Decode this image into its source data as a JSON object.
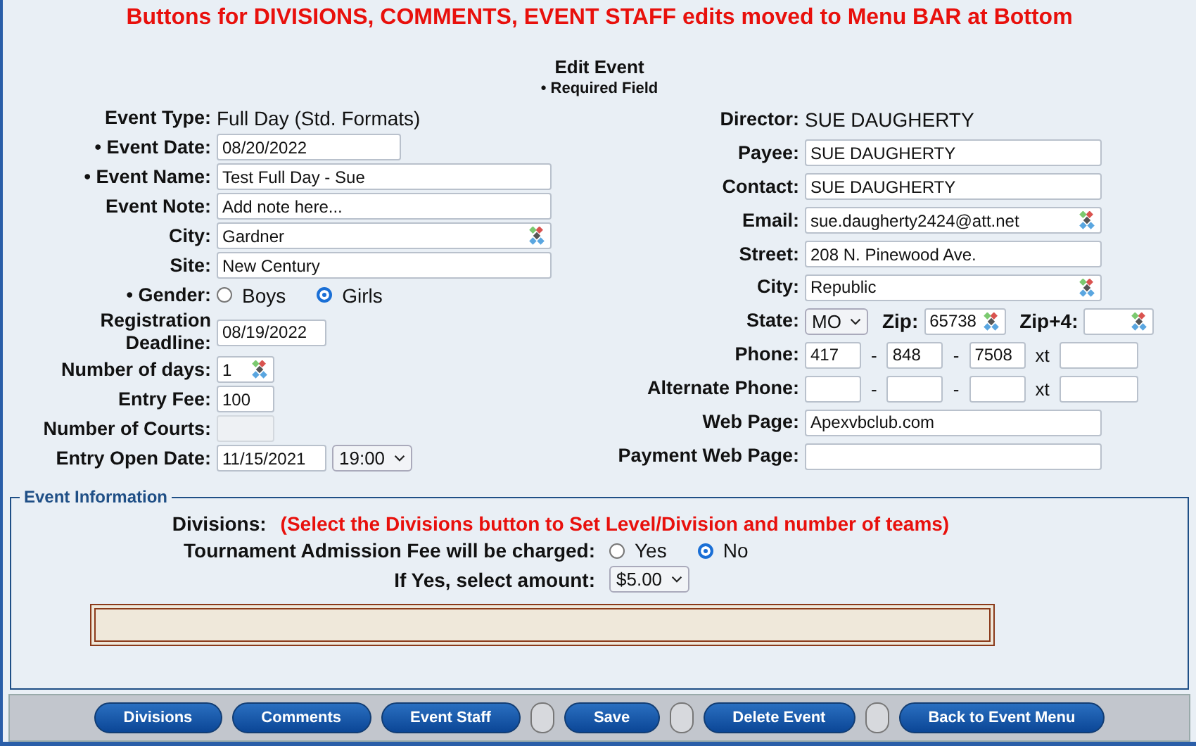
{
  "banner": "Buttons for DIVISIONS, COMMENTS, EVENT STAFF edits moved to Menu BAR at Bottom",
  "title": "Edit Event",
  "required_note": {
    "bullet": "•",
    "text": "Required Field"
  },
  "left_fields": [
    {
      "kind": "static",
      "label": "Event Type:",
      "value": "Full Day (Std. Formats)"
    },
    {
      "kind": "date",
      "label": "• Event Date:",
      "value": "08/20/2022"
    },
    {
      "kind": "wide",
      "label": "• Event Name:",
      "value": "Test Full Day - Sue"
    },
    {
      "kind": "wide",
      "label": "Event Note:",
      "value": "Add note here..."
    },
    {
      "kind": "wide",
      "label": "City:",
      "value": "Gardner",
      "picker": true
    },
    {
      "kind": "wide",
      "label": "Site:",
      "value": "New Century"
    },
    {
      "kind": "radio",
      "label": "• Gender:",
      "options": [
        {
          "label": "Boys",
          "selected": false
        },
        {
          "label": "Girls",
          "selected": true
        }
      ]
    },
    {
      "kind": "narrow",
      "label": "Registration Deadline:",
      "value": "08/19/2022"
    },
    {
      "kind": "small",
      "label": "Number of days:",
      "value": "1",
      "picker": true
    },
    {
      "kind": "small",
      "label": "Entry Fee:",
      "value": "100"
    },
    {
      "kind": "small",
      "label": "Number of Courts:",
      "disabled": true
    },
    {
      "kind": "datetime",
      "label": "Entry Open Date:",
      "value": "11/15/2021",
      "time": "19:00"
    }
  ],
  "right_fields": [
    {
      "kind": "static",
      "label": "Director:",
      "value": "SUE DAUGHERTY"
    },
    {
      "kind": "input",
      "label": "Payee:",
      "value": "SUE DAUGHERTY"
    },
    {
      "kind": "input",
      "label": "Contact:",
      "value": "SUE DAUGHERTY"
    },
    {
      "kind": "input",
      "label": "Email:",
      "value": "sue.daugherty2424@att.net",
      "picker": true
    },
    {
      "kind": "input",
      "label": "Street:",
      "value": "208 N. Pinewood Ave."
    },
    {
      "kind": "input",
      "label": "City:",
      "value": "Republic",
      "picker": true
    },
    {
      "kind": "state",
      "label": "State:",
      "value": "MO",
      "zip_label": "Zip:",
      "zip": "65738",
      "zip4_label": "Zip+4:"
    },
    {
      "kind": "phone",
      "label": "Phone:",
      "parts": [
        "417",
        "848",
        "7508"
      ],
      "separators": [
        "-",
        "-"
      ],
      "ext_label": "xt"
    },
    {
      "kind": "phone",
      "label": "Alternate Phone:",
      "separators": [
        "-",
        "-"
      ],
      "ext_label": "xt"
    },
    {
      "kind": "input",
      "label": "Web Page:",
      "value": "Apexvbclub.com"
    },
    {
      "kind": "input",
      "label": "Payment Web Page:"
    }
  ],
  "event_information": {
    "legend": "Event Information",
    "divisions_label": "Divisions:",
    "divisions_note": "(Select the Divisions button to Set Level/Division and number of teams)",
    "admission_label": "Tournament Admission Fee will be charged:",
    "admission_options": [
      {
        "label": "Yes",
        "selected": false
      },
      {
        "label": "No",
        "selected": true
      }
    ],
    "amount_label": "If Yes, select amount:",
    "amount": "$5.00"
  },
  "menu_bar": [
    {
      "kind": "button",
      "label": "Divisions"
    },
    {
      "kind": "button",
      "label": "Comments"
    },
    {
      "kind": "button",
      "label": "Event Staff"
    },
    {
      "kind": "spacer"
    },
    {
      "kind": "button",
      "label": "Save"
    },
    {
      "kind": "spacer"
    },
    {
      "kind": "button",
      "label": "Delete Event"
    },
    {
      "kind": "spacer"
    },
    {
      "kind": "button",
      "label": "Back to Event Menu"
    }
  ]
}
